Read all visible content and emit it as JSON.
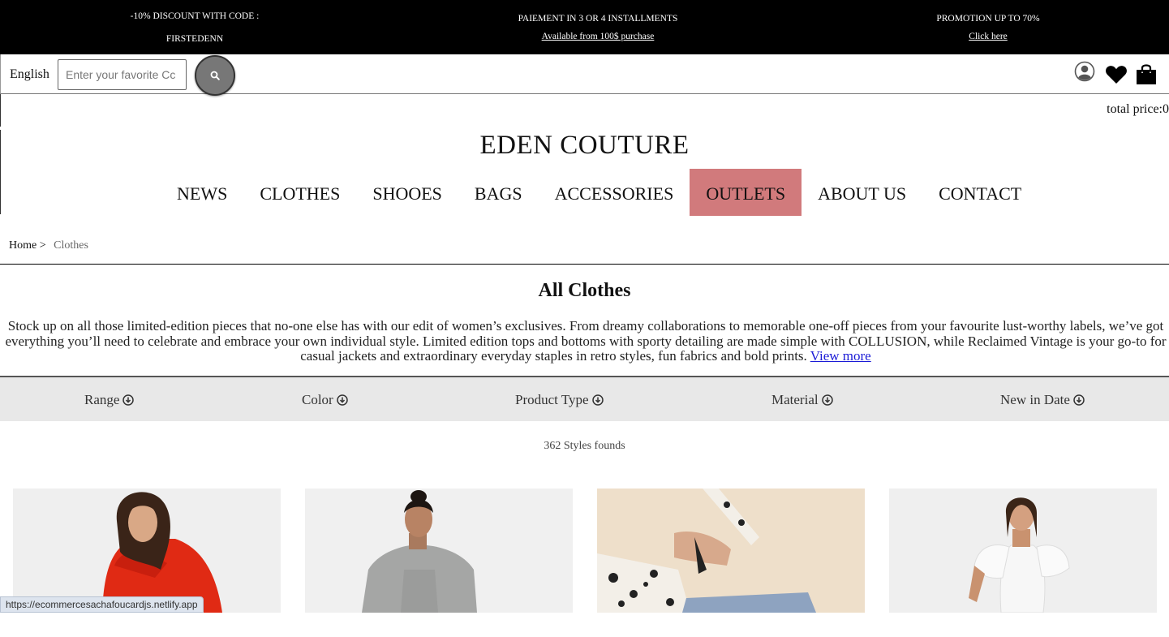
{
  "promo": [
    {
      "line1": "-10% DISCOUNT WITH CODE :",
      "line2": "FIRSTEDENN"
    },
    {
      "line1": "PAIEMENT IN 3 OR 4 INSTALLMENTS",
      "line2": "Available from 100$ purchase"
    },
    {
      "line1": "PROMOTION UP TO 70%",
      "line2": "Click here"
    }
  ],
  "header": {
    "language": "English",
    "search_placeholder": "Enter your favorite Cc",
    "search_value": "",
    "total_price": "total price:0",
    "icons": [
      "search-icon",
      "user-icon",
      "heart-icon",
      "shopping-bag-icon"
    ]
  },
  "brand": {
    "logo": "EDEN COUTURE",
    "accent": "#d17a7c"
  },
  "nav": {
    "items": [
      "NEWS",
      "CLOTHES",
      "SHOOES",
      "BAGS",
      "ACCESSORIES",
      "OUTLETS",
      "ABOUT US",
      "CONTACT"
    ],
    "active": "OUTLETS"
  },
  "breadcrumb": {
    "home": "Home >",
    "current": "Clothes"
  },
  "main": {
    "title": "All Clothes",
    "description": "Stock up on all those limited-edition pieces that no-one else has with our edit of women’s exclusives. From dreamy collaborations to memorable one-off pieces from your favourite lust-worthy labels, we’ve got everything you’ll need to celebrate and embrace your own individual style. Limited edition tops and bottoms with sporty detailing are made simple with COLLUSION, while Reclaimed Vintage is your go-to for casual jackets and extraordinary everyday staples in retro styles, fun fabrics and bold prints.",
    "view_more": "View more",
    "styles_found": "362 Styles founds"
  },
  "filters": [
    "Range",
    "Color",
    "Product Type",
    "Material",
    "New in Date"
  ],
  "products": [
    {
      "alt": "woman in red puffer jacket"
    },
    {
      "alt": "woman in grey corset dress"
    },
    {
      "alt": "cream jumper with spotted fleece bag"
    },
    {
      "alt": "woman in white puff sleeve dress"
    }
  ],
  "status_url": "https://ecommercesachafoucardjs.netlify.app"
}
